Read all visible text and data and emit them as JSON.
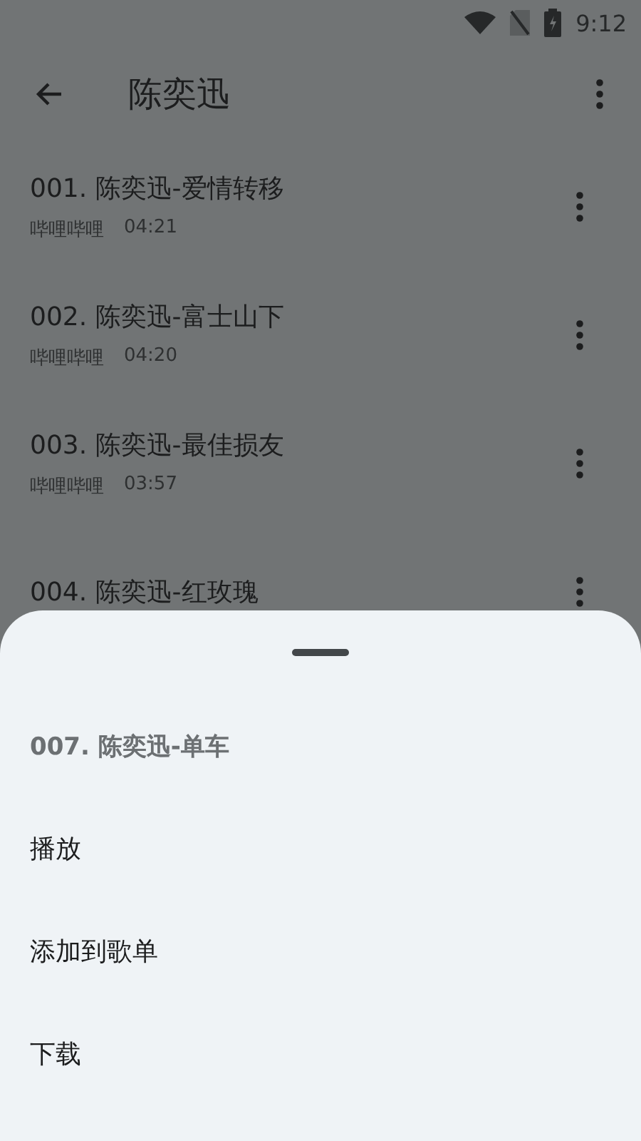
{
  "status_bar": {
    "time": "9:12"
  },
  "toolbar": {
    "title": "陈奕迅"
  },
  "songs": [
    {
      "title": "001. 陈奕迅-爱情转移",
      "source": "哔哩哔哩",
      "duration": "04:21"
    },
    {
      "title": "002. 陈奕迅-富士山下",
      "source": "哔哩哔哩",
      "duration": "04:20"
    },
    {
      "title": "003. 陈奕迅-最佳损友",
      "source": "哔哩哔哩",
      "duration": "03:57"
    },
    {
      "title": "004. 陈奕迅-红玫瑰"
    }
  ],
  "bottom_sheet": {
    "title": "007. 陈奕迅-单车",
    "actions": [
      "播放",
      "添加到歌单",
      "下载"
    ]
  }
}
